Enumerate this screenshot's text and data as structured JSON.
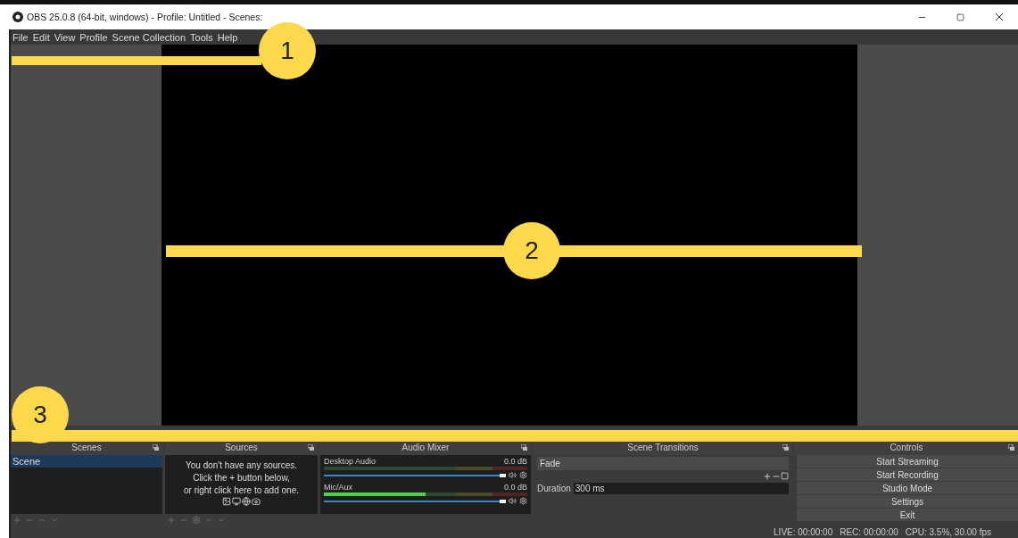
{
  "window": {
    "title": "OBS 25.0.8 (64-bit, windows) - Profile: Untitled - Scenes:"
  },
  "menu": [
    "File",
    "Edit",
    "View",
    "Profile",
    "Scene Collection",
    "Tools",
    "Help"
  ],
  "annotations": [
    {
      "label": "1"
    },
    {
      "label": "2"
    },
    {
      "label": "3"
    }
  ],
  "scenes": {
    "title": "Scenes",
    "items": [
      {
        "label": "Scene",
        "selected": true
      }
    ]
  },
  "sources": {
    "title": "Sources",
    "empty_message": [
      "You don't have any sources.",
      "Click the + button below,",
      "or right click here to add one."
    ]
  },
  "audio_mixer": {
    "title": "Audio Mixer",
    "channels": [
      {
        "name": "Desktop Audio",
        "reading": "0.0 dB",
        "volume": {
          "level": 1
        }
      },
      {
        "name": "Mic/Aux",
        "reading": "0.0 dB",
        "level": 0.5,
        "volume": {
          "level": 1
        }
      }
    ]
  },
  "scene_transitions": {
    "title": "Scene Transitions",
    "transition": "Fade",
    "duration_label": "Duration",
    "duration": "300 ms"
  },
  "controls": {
    "title": "Controls",
    "buttons": [
      "Start Streaming",
      "Start Recording",
      "Studio Mode",
      "Settings",
      "Exit"
    ]
  },
  "status_bar": {
    "live": "LIVE: 00:00:00",
    "rec": "REC: 00:00:00",
    "cpu": "CPU: 3.5%, 30.00 fps"
  }
}
